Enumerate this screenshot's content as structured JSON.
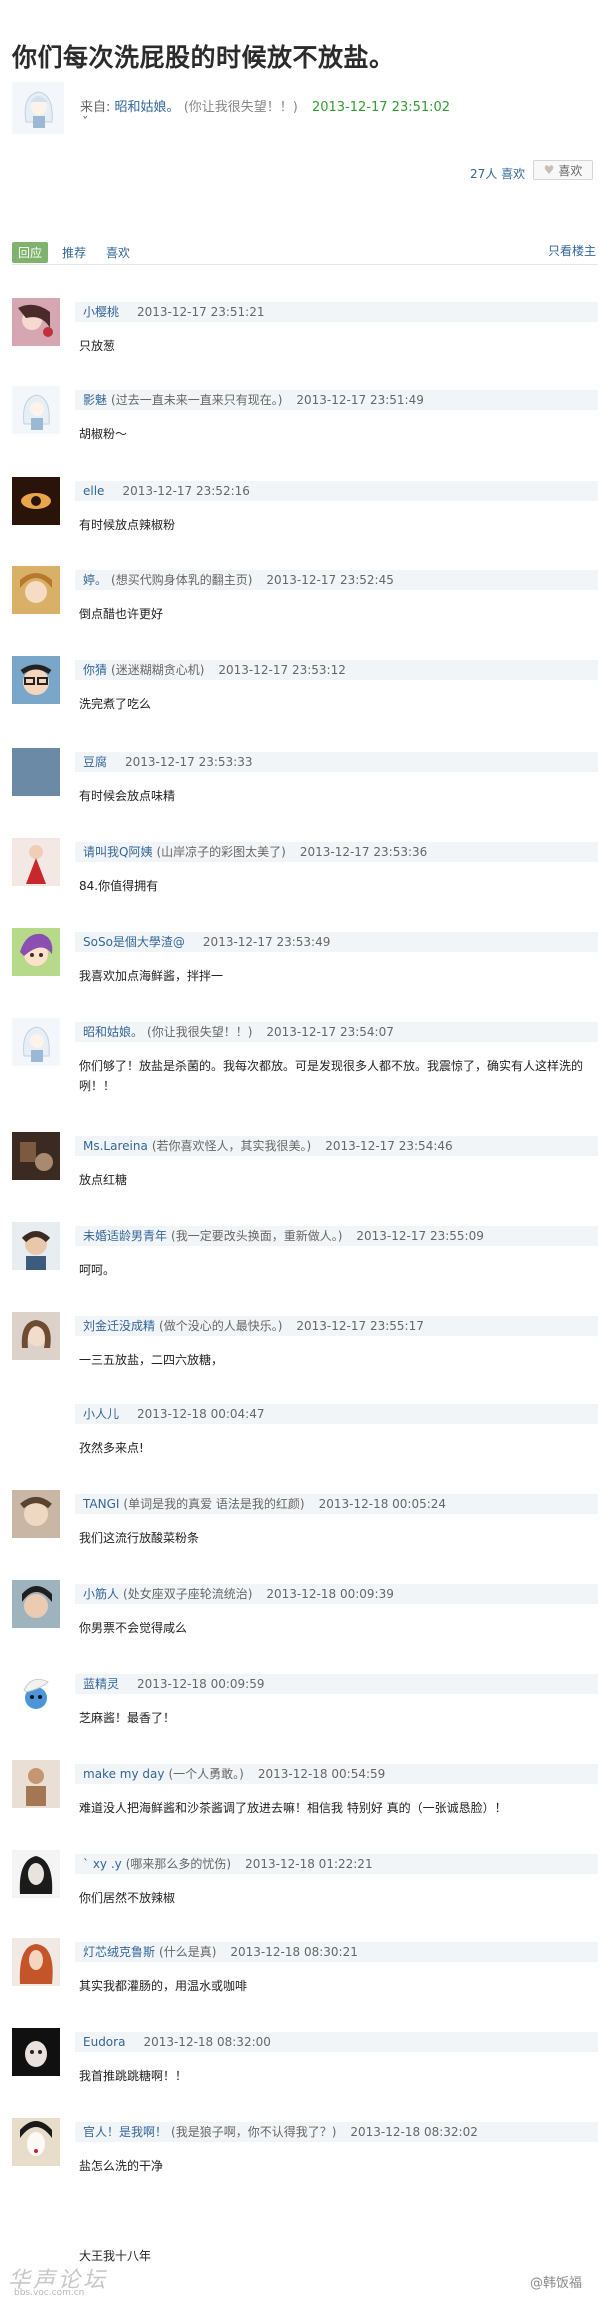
{
  "post": {
    "title": "你们每次洗屁股的时候放不放盐。",
    "from_label": "来自:",
    "author": "昭和姑娘。",
    "author_sig": "(你让我很失望！！)",
    "time": "2013-12-17 23:51:02",
    "extra": "ˇ",
    "likes_text": "27人 喜欢",
    "like_button": "喜欢"
  },
  "tabs": {
    "reply": "回应",
    "recommend": "推荐",
    "like": "喜欢",
    "only_op": "只看楼主"
  },
  "replies": [
    {
      "user": "小樱桃",
      "sig": "",
      "time": "2013-12-17 23:51:21",
      "text": "只放葱"
    },
    {
      "user": "影魅",
      "sig": "(过去一直未来一直来只有现在。)",
      "time": "2013-12-17 23:51:49",
      "text": "胡椒粉～"
    },
    {
      "user": "elle",
      "sig": "",
      "time": "2013-12-17 23:52:16",
      "text": "有时候放点辣椒粉"
    },
    {
      "user": "婷。",
      "sig": "(想买代购身体乳的翻主页)",
      "time": "2013-12-17 23:52:45",
      "text": "倒点醋也许更好"
    },
    {
      "user": "你猜",
      "sig": "(迷迷糊糊贪心机)",
      "time": "2013-12-17 23:53:12",
      "text": "洗完煮了吃么"
    },
    {
      "user": "豆腐",
      "sig": "",
      "time": "2013-12-17 23:53:33",
      "text": "有时候会放点味精"
    },
    {
      "user": "请叫我Q阿姨",
      "sig": "(山岸凉子的彩图太美了)",
      "time": "2013-12-17 23:53:36",
      "text": "84.你值得拥有"
    },
    {
      "user": "SoSo是個大學渣@",
      "sig": "",
      "time": "2013-12-17 23:53:49",
      "text": "我喜欢加点海鲜酱，拌拌一"
    },
    {
      "user": "昭和姑娘。",
      "sig": "(你让我很失望！！)",
      "time": "2013-12-17 23:54:07",
      "text": "你们够了！放盐是杀菌的。我每次都放。可是发现很多人都不放。我震惊了，确实有人这样洗的咧！！"
    },
    {
      "user": "Ms.Lareina",
      "sig": "(若你喜欢怪人，其实我很美。)",
      "time": "2013-12-17 23:54:46",
      "text": "放点红糖"
    },
    {
      "user": "未婚适龄男青年",
      "sig": "(我一定要改头换面，重新做人。)",
      "time": "2013-12-17 23:55:09",
      "text": "呵呵。"
    },
    {
      "user": "刘金迁没成精",
      "sig": "(做个没心的人最快乐。)",
      "time": "2013-12-17 23:55:17",
      "text": "一三五放盐，二四六放糖，"
    },
    {
      "user": "小人儿",
      "sig": "",
      "time": "2013-12-18 00:04:47",
      "text": "孜然多来点!"
    },
    {
      "user": "TANGI",
      "sig": "(单词是我的真爱 语法是我的红颜)",
      "time": "2013-12-18 00:05:24",
      "text": "我们这流行放酸菜粉条"
    },
    {
      "user": "小筋人",
      "sig": "(处女座双子座轮流统治)",
      "time": "2013-12-18 00:09:39",
      "text": "你男票不会觉得咸么"
    },
    {
      "user": "蓝精灵",
      "sig": "",
      "time": "2013-12-18 00:09:59",
      "text": "芝麻酱！最香了！"
    },
    {
      "user": "make my day",
      "sig": "(一个人勇敢。)",
      "time": "2013-12-18 00:54:59",
      "text": "难道没人把海鲜酱和沙茶酱调了放进去嘛！相信我 特别好 真的（一张诚恳脸）！"
    },
    {
      "user": "` xy .y",
      "sig": "(哪来那么多的忧伤)",
      "time": "2013-12-18 01:22:21",
      "text": "你们居然不放辣椒"
    },
    {
      "user": "灯芯绒克鲁斯",
      "sig": "(什么是真)",
      "time": "2013-12-18 08:30:21",
      "text": "其实我都灌肠的，用温水或咖啡"
    },
    {
      "user": "Eudora",
      "sig": "",
      "time": "2013-12-18 08:32:00",
      "text": "我首推跳跳糖啊！！"
    },
    {
      "user": "官人！是我啊！",
      "sig": "(我是狼子啊，你不认得我了？)",
      "time": "2013-12-18 08:32:02",
      "text": "盐怎么洗的干净"
    }
  ],
  "partial_text": "大王我十八年",
  "watermark": {
    "left_logo": "华声论坛",
    "left_url": "bbs.voc.com.cn",
    "right": "@韩饭福"
  },
  "colors": {
    "link": "#336699",
    "timestamp_green": "#339933",
    "active_tab": "#7fb36d",
    "reply_header_bg": "#f2f5f7"
  },
  "avatars": [
    "cherry-girl",
    "white-hair-avatar",
    "dark-eye-avatar",
    "blonde-girl",
    "glasses-face",
    "steel-blue-square",
    "red-dress-girl",
    "cartoon-girl",
    "white-hair-avatar",
    "dark-room",
    "thinking-boy",
    "brown-hair-girl",
    "none",
    "beige-face",
    "dark-hair-boy",
    "smurf",
    "tan-figure",
    "ink-portrait",
    "red-hair-girl",
    "dark-face",
    "geisha"
  ]
}
